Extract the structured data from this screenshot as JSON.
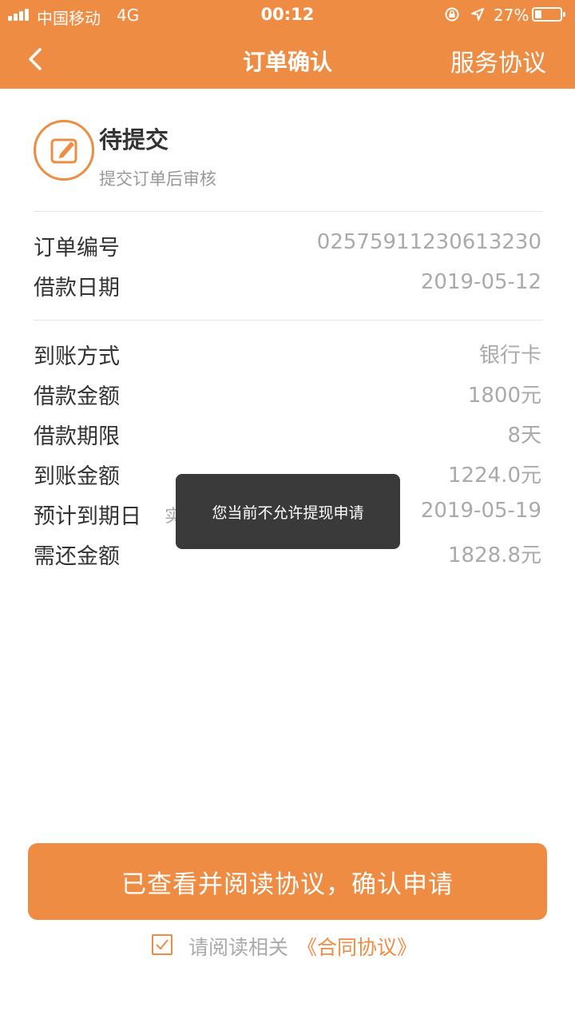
{
  "status_bar": {
    "carrier": "中国移动",
    "network": "4G",
    "time": "00:12",
    "battery": "27%",
    "battery_level": 0.27
  },
  "nav": {
    "title": "订单确认",
    "right_action": "服务协议"
  },
  "order_status": {
    "title": "待提交",
    "subtitle": "提交订单后审核"
  },
  "order_info": [
    {
      "label": "订单编号",
      "value": "02575911230613230"
    },
    {
      "label": "借款日期",
      "value": "2019-05-12"
    }
  ],
  "loan_details": [
    {
      "label": "到账方式",
      "value": "银行卡"
    },
    {
      "label": "借款金额",
      "value": "1800元"
    },
    {
      "label": "借款期限",
      "value": "8天"
    },
    {
      "label": "到账金额",
      "value": "1224.0元"
    },
    {
      "label": "预计到期日",
      "value": "2019-05-19",
      "note": "实"
    },
    {
      "label": "需还金额",
      "value": "1828.8元"
    }
  ],
  "toast": {
    "message": "您当前不允许提现申请"
  },
  "confirm_button": {
    "label": "已查看并阅读协议，确认申请"
  },
  "agreement": {
    "prefix": "请阅读相关",
    "link": "《合同协议》",
    "checked": true
  },
  "colors": {
    "accent": "#EE8C44",
    "text": "#333333",
    "muted": "#AAAAAA",
    "toast_bg": "#3A3A3A"
  },
  "icons": {
    "back": "chevron-left-icon",
    "status": "edit-document-icon",
    "checkbox": "checkmark-icon"
  }
}
